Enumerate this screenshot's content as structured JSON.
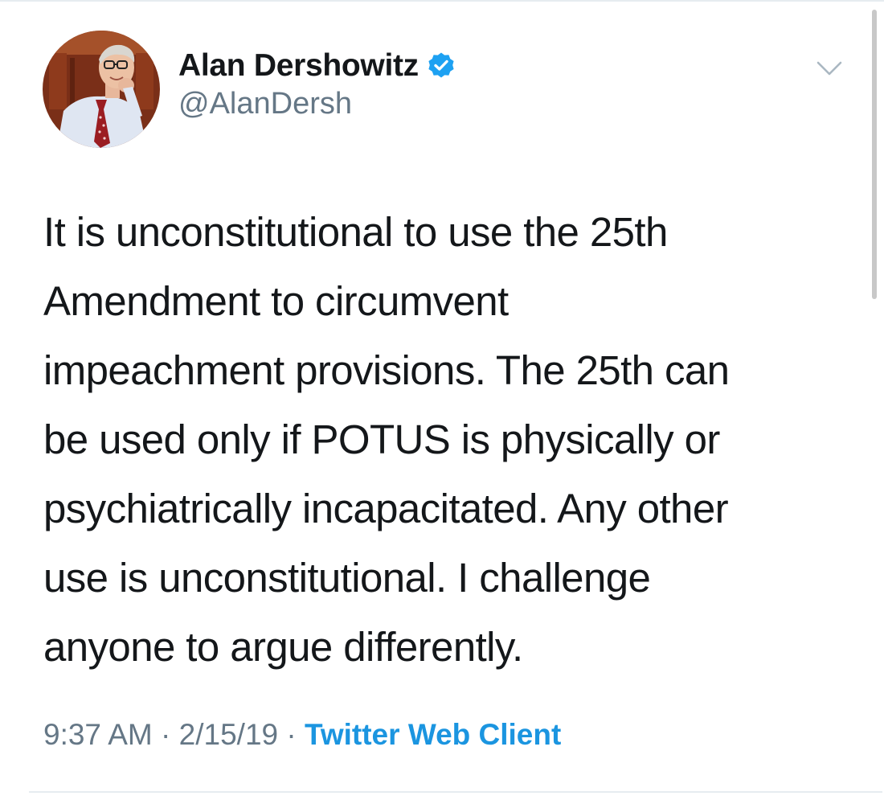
{
  "author": {
    "display_name": "Alan Dershowitz",
    "handle": "@AlanDersh",
    "verified": true
  },
  "tweet": {
    "lines": [
      "It is unconstitutional to use the 25th",
      "Amendment to circumvent",
      "impeachment provisions. The 25th can",
      "be used only if POTUS is physically or",
      "psychiatrically incapacitated. Any other",
      "use is unconstitutional. I challenge",
      "anyone to argue differently."
    ]
  },
  "meta": {
    "time": "9:37 AM",
    "separator": " · ",
    "date": "2/15/19",
    "source": "Twitter Web Client"
  },
  "icons": {
    "verified": "verified-badge-icon",
    "caret": "chevron-down-icon"
  },
  "colors": {
    "text": "#14171a",
    "secondary": "#657786",
    "link": "#1b95e0",
    "verified": "#1da1f2"
  }
}
